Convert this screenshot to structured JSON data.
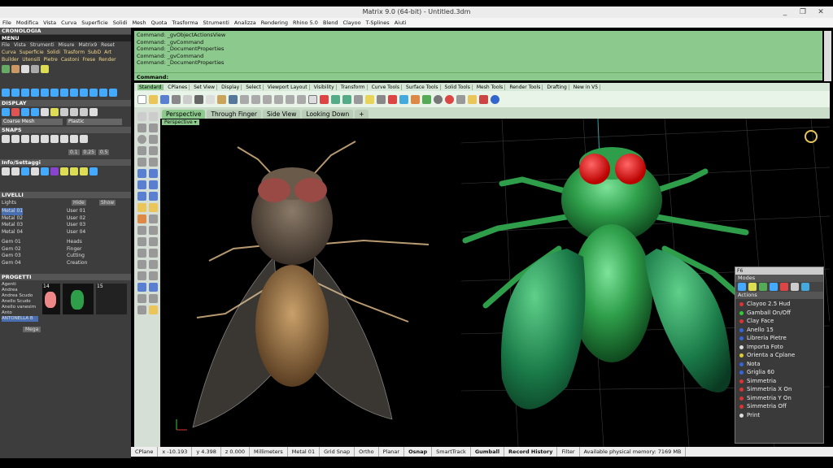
{
  "window": {
    "title": "Matrix 9.0 (64-bit) - Untitled.3dm",
    "min": "_",
    "max": "❐",
    "close": "✕"
  },
  "menubar": [
    "File",
    "Modifica",
    "Vista",
    "Curva",
    "Superficie",
    "Solidi",
    "Mesh",
    "Quota",
    "Trasforma",
    "Strumenti",
    "Analizza",
    "Rendering",
    "Rhino 5.0",
    "Blend",
    "Clayoo",
    "T-Splines",
    "Aiuti"
  ],
  "left": {
    "cronologia": "CRONOLOGIA",
    "menu": "MENU",
    "menu_items": [
      "File",
      "Vista",
      "Strumenti",
      "Misure",
      "Matrix9",
      "Reset"
    ],
    "row1": [
      "Curva",
      "Superficie",
      "Solidi",
      "Trasform",
      "SubD",
      "Art"
    ],
    "row2": [
      "Builder",
      "Utensili",
      "Pietre",
      "Castoni",
      "Frese",
      "Render"
    ],
    "display": "DISPLAY",
    "display_left": "Coarse Mesh",
    "display_right": "Plastic",
    "snaps": "SNAPS",
    "snap_vals": [
      "0.1",
      "0.25",
      "0.5"
    ],
    "info": "Info/Settaggi",
    "livelli": "LIVELLI",
    "lights": "Lights",
    "hide": "Hide",
    "show": "Show",
    "layers_left": [
      "Metal 01",
      "Metal 02",
      "Metal 03",
      "Metal 04",
      "Gem 01",
      "Gem 02",
      "Gem 03",
      "Gem 04"
    ],
    "layers_right": [
      "User 01",
      "User 02",
      "User 03",
      "User 04",
      "Heads",
      "Finger",
      "Cutting",
      "Creation"
    ],
    "progetti": "PROGETTI",
    "projects": [
      "Agenti",
      "Andrea",
      "Andrea Scudo",
      "Anello Scudo",
      "Anello vanesim",
      "Anto",
      "ANTONELLA B"
    ],
    "thumbs": [
      "14",
      "15"
    ],
    "mega": "Mega"
  },
  "commands": [
    "Command: _gvObjectActionsView",
    "Command: _gvCommand",
    "Command: _DocumentProperties",
    "Command: _gvCommand",
    "Command: _DocumentProperties"
  ],
  "command_prompt": "Command:",
  "tabs": [
    "Standard",
    "CPlanes",
    "Set View",
    "Display",
    "Select",
    "Viewport Layout",
    "Visibility",
    "Transform",
    "Curve Tools",
    "Surface Tools",
    "Solid Tools",
    "Mesh Tools",
    "Render Tools",
    "Drafting",
    "New in V5"
  ],
  "viewtabs": [
    "Perspective",
    "Through Finger",
    "Side View",
    "Looking Down",
    "+"
  ],
  "viewport_label": "Perspective ▾",
  "f6": {
    "title": "F6",
    "modes": "Modes",
    "actions": "Actions",
    "items": [
      {
        "label": "Clayoo 2.5 Hud",
        "color": "#d33"
      },
      {
        "label": "Gamball   On/Off",
        "color": "#3c3"
      },
      {
        "label": "Clay Face",
        "color": "#d33"
      },
      {
        "label": "Anello 15",
        "color": "#36d"
      },
      {
        "label": "Libreria Pietre",
        "color": "#36d"
      },
      {
        "label": "Importa Foto",
        "color": "#ddd"
      },
      {
        "label": "Orienta a Cplane",
        "color": "#dc3"
      },
      {
        "label": "Nota",
        "color": "#36d"
      },
      {
        "label": "Griglia 60",
        "color": "#36d"
      },
      {
        "label": "Simmetria",
        "color": "#d33"
      },
      {
        "label": "Simmetria X On",
        "color": "#d33"
      },
      {
        "label": "Simmetria Y On",
        "color": "#d33"
      },
      {
        "label": "Simmetria Off",
        "color": "#d33"
      },
      {
        "label": "Print",
        "color": "#ddd"
      }
    ]
  },
  "status": {
    "cplane": "CPlane",
    "x": "x -10.193",
    "y": "y 4.398",
    "z": "z 0.000",
    "units": "Millimeters",
    "layer": "Metal 01",
    "toggles": [
      "Grid Snap",
      "Ortho",
      "Planar",
      "Osnap",
      "SmartTrack",
      "Gumball",
      "Record History",
      "Filter"
    ],
    "memory": "Available physical memory: 7169 MB"
  },
  "colors": {
    "accent_green": "#8cc98c",
    "fly_green": "#2e9e4a"
  }
}
